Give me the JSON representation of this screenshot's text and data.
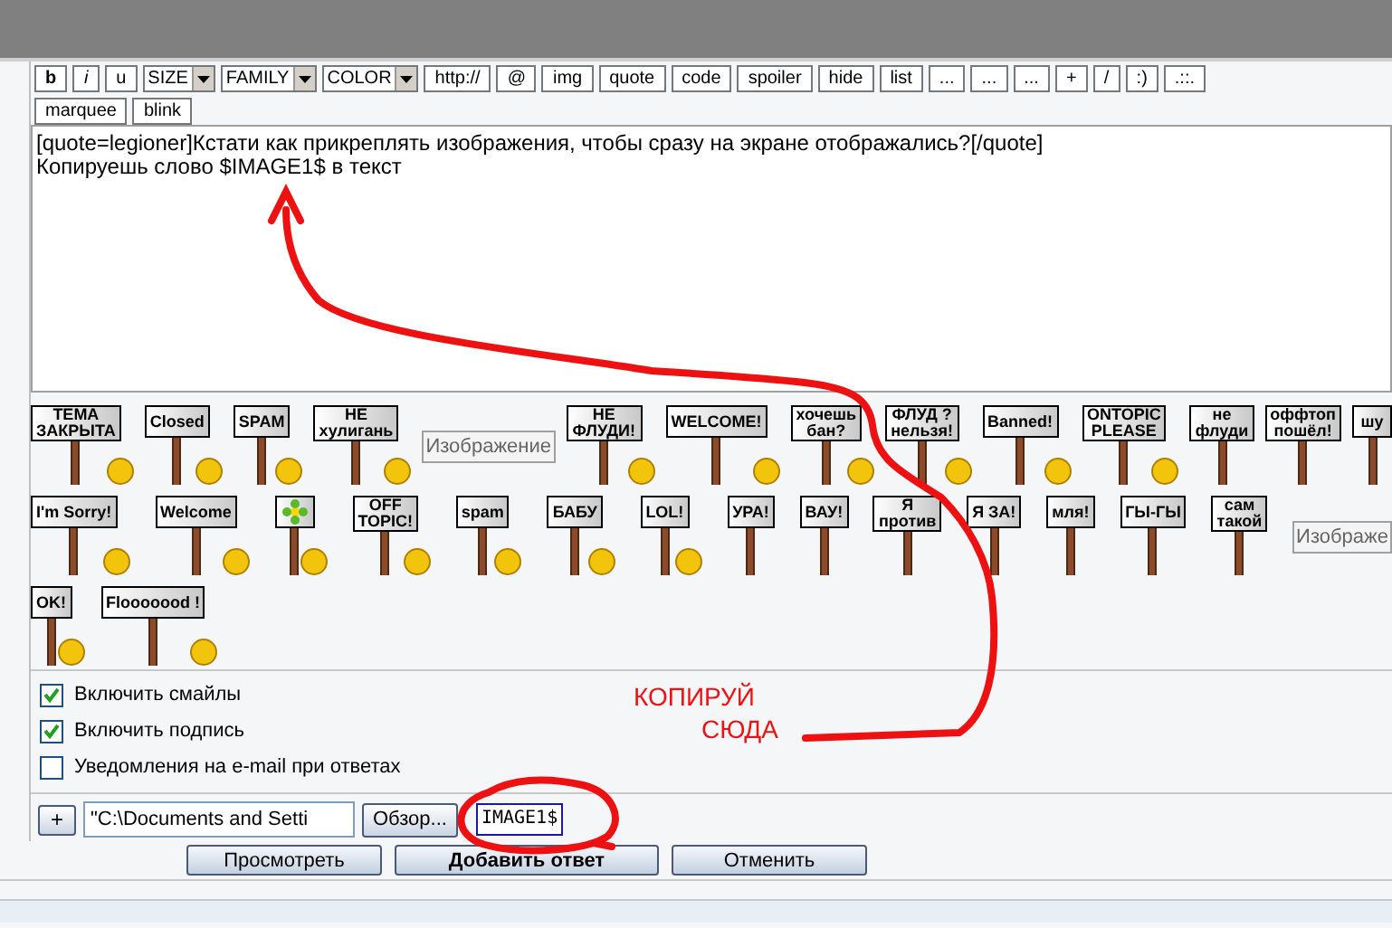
{
  "toolbar": [
    {
      "buttons": [
        {
          "kind": "button",
          "label": "b"
        },
        {
          "kind": "button",
          "label": "i"
        },
        {
          "kind": "button",
          "label": "u"
        },
        {
          "kind": "select",
          "label": "SIZE"
        },
        {
          "kind": "select",
          "label": "FAMILY"
        },
        {
          "kind": "select",
          "label": "COLOR"
        },
        {
          "kind": "button",
          "label": "http://"
        },
        {
          "kind": "button",
          "label": "@"
        },
        {
          "kind": "button",
          "label": "img"
        },
        {
          "kind": "button",
          "label": "quote"
        },
        {
          "kind": "button",
          "label": "code"
        },
        {
          "kind": "button",
          "label": "spoiler"
        },
        {
          "kind": "button",
          "label": "hide"
        },
        {
          "kind": "button",
          "label": "list"
        },
        {
          "kind": "button",
          "label": "..."
        },
        {
          "kind": "button",
          "label": "..."
        },
        {
          "kind": "button",
          "label": "..."
        },
        {
          "kind": "button",
          "label": "+"
        },
        {
          "kind": "button",
          "label": "/"
        },
        {
          "kind": "button",
          "label": ":)"
        },
        {
          "kind": "button",
          "label": ".::."
        }
      ]
    },
    {
      "buttons": [
        {
          "kind": "button",
          "label": "marquee"
        },
        {
          "kind": "button",
          "label": "blink"
        }
      ]
    }
  ],
  "message": {
    "lines": [
      "[quote=legioner]Кстати как прикреплять изображения, чтобы сразу на экране отображались?[/quote]",
      "Копируешь слово $IMAGE1$ в текст"
    ]
  },
  "smileys": [
    {
      "items": [
        {
          "kind": "smiley",
          "text": "ТЕМА\nЗАКРЫТА"
        },
        {
          "kind": "smiley",
          "text": "Closed"
        },
        {
          "kind": "smiley",
          "text": "SPAM"
        },
        {
          "kind": "smiley",
          "text": "НЕ\nхулигань"
        },
        {
          "kind": "missing",
          "text": "Изображение"
        },
        {
          "kind": "smiley",
          "text": "НЕ ФЛУДИ!"
        },
        {
          "kind": "smiley",
          "text": "WELCOME!"
        },
        {
          "kind": "smiley",
          "text": "хочешь\nбан?"
        },
        {
          "kind": "smiley",
          "text": "ФЛУД ?\nнельзя!"
        },
        {
          "kind": "smiley",
          "text": "Banned!"
        },
        {
          "kind": "smiley",
          "text": "ONTOPIC\nPLEASE"
        },
        {
          "kind": "sign",
          "text": "не\nфлуди"
        },
        {
          "kind": "sign",
          "text": "оффтоп\nпошёл!"
        },
        {
          "kind": "sign",
          "text": "шу"
        }
      ]
    },
    {
      "items": [
        {
          "kind": "smiley",
          "text": "I'm Sorry!"
        },
        {
          "kind": "smiley",
          "text": "Welcome"
        },
        {
          "kind": "flower"
        },
        {
          "kind": "smiley",
          "text": "OFF\nTOPIC!"
        },
        {
          "kind": "smiley",
          "text": "spam"
        },
        {
          "kind": "smiley",
          "text": "БАБУ"
        },
        {
          "kind": "smiley",
          "text": "LOL!"
        },
        {
          "kind": "sign",
          "text": "УРА!"
        },
        {
          "kind": "sign",
          "text": "ВАУ!"
        },
        {
          "kind": "sign",
          "text": "Я\nпротив"
        },
        {
          "kind": "sign",
          "text": "Я ЗА!"
        },
        {
          "kind": "sign",
          "text": "мля!"
        },
        {
          "kind": "sign",
          "text": "ГЫ-ГЫ"
        },
        {
          "kind": "sign",
          "text": "сам\nтакой"
        },
        {
          "kind": "missing",
          "text": "Изображе"
        }
      ]
    },
    {
      "items": [
        {
          "kind": "smiley",
          "text": "OK!"
        },
        {
          "kind": "smiley",
          "text": "Flooooood !"
        }
      ]
    }
  ],
  "options": [
    {
      "label": "Включить смайлы",
      "checked": true
    },
    {
      "label": "Включить подпись",
      "checked": true
    },
    {
      "label": "Уведомления на e-mail при ответах",
      "checked": false
    }
  ],
  "attachment": {
    "add": "+",
    "file_value": "\"C:\\Documents and Setti",
    "browse": "Обзор...",
    "tag_value": "IMAGE1$"
  },
  "buttons": [
    {
      "label": "Просмотреть",
      "primary": false
    },
    {
      "label": "Добавить ответ",
      "primary": true
    },
    {
      "label": "Отменить",
      "primary": false
    }
  ],
  "annotation": {
    "lines": [
      "КОПИРУЙ",
      "СЮДА"
    ]
  }
}
